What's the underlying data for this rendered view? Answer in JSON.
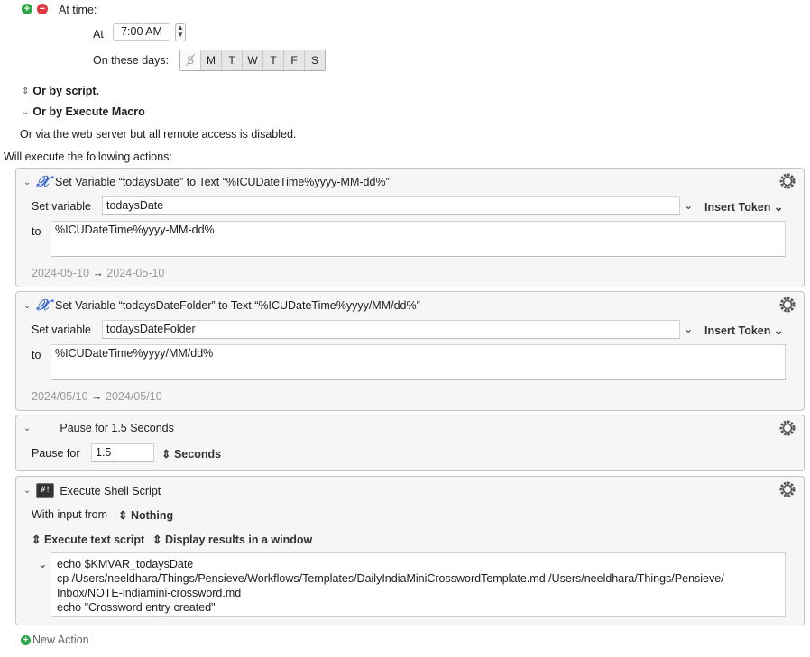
{
  "trigger": {
    "at_time_label": "At time:",
    "at_label": "At",
    "time_value": "7:00 AM",
    "days_label": "On these days:",
    "days": [
      "S",
      "M",
      "T",
      "W",
      "T",
      "F",
      "S"
    ],
    "or_by_script": "Or by script.",
    "or_by_execute_macro": "Or by Execute Macro",
    "web_server_note": "Or via the web server but all remote access is disabled."
  },
  "will_execute_label": "Will execute the following actions:",
  "actions": [
    {
      "title": "Set Variable “todaysDate” to Text “%ICUDateTime%yyyy-MM-dd%”",
      "set_variable_label": "Set variable",
      "variable_name": "todaysDate",
      "insert_token": "Insert Token",
      "to_label": "to",
      "text_value": "%ICUDateTime%yyyy-MM-dd%",
      "preview_from": "2024-05-10",
      "preview_arrow": "→",
      "preview_to": "2024-05-10"
    },
    {
      "title": "Set Variable “todaysDateFolder” to Text “%ICUDateTime%yyyy/MM/dd%”",
      "set_variable_label": "Set variable",
      "variable_name": "todaysDateFolder",
      "insert_token": "Insert Token",
      "to_label": "to",
      "text_value": "%ICUDateTime%yyyy/MM/dd%",
      "preview_from": "2024/05/10",
      "preview_arrow": "→",
      "preview_to": "2024/05/10"
    },
    {
      "title": "Pause for 1.5 Seconds",
      "pause_label": "Pause for",
      "pause_value": "1.5",
      "unit": "Seconds"
    },
    {
      "title": "Execute Shell Script",
      "icon_text": "#!",
      "input_label": "With input from",
      "input_value": "Nothing",
      "mode": "Execute text script",
      "output": "Display results in a window",
      "script_lines": [
        "echo $KMVAR_todaysDate",
        "cp /Users/neeldhara/Things/Pensieve/Workflows/Templates/DailyIndiaMiniCrosswordTemplate.md /Users/neeldhara/Things/Pensieve/",
        "Inbox/NOTE-indiamini-crossword.md",
        "echo \"Crossword entry created\""
      ]
    }
  ],
  "new_action": "New Action",
  "colors": {
    "accent": "#3b6bd6",
    "add_green": "#28a745",
    "remove_red": "#e0353b"
  }
}
